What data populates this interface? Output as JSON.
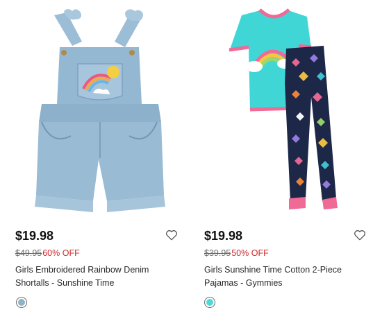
{
  "products": [
    {
      "price": "$19.98",
      "original_price": "$49.95",
      "discount": "60% OFF",
      "title": "Girls Embroidered Rainbow Denim Shortalls - Sunshine Time",
      "image_icon": "denim-shortalls-image",
      "swatch_color": "#8fb2c7"
    },
    {
      "price": "$19.98",
      "original_price": "$39.95",
      "discount": "50% OFF",
      "title": "Girls Sunshine Time Cotton 2-Piece Pajamas - Gymmies",
      "image_icon": "pajamas-image",
      "swatch_color": "#4fd9d9"
    }
  ],
  "colors": {
    "sale_red": "#d0272b",
    "strike_gray": "#6b6b6b"
  }
}
